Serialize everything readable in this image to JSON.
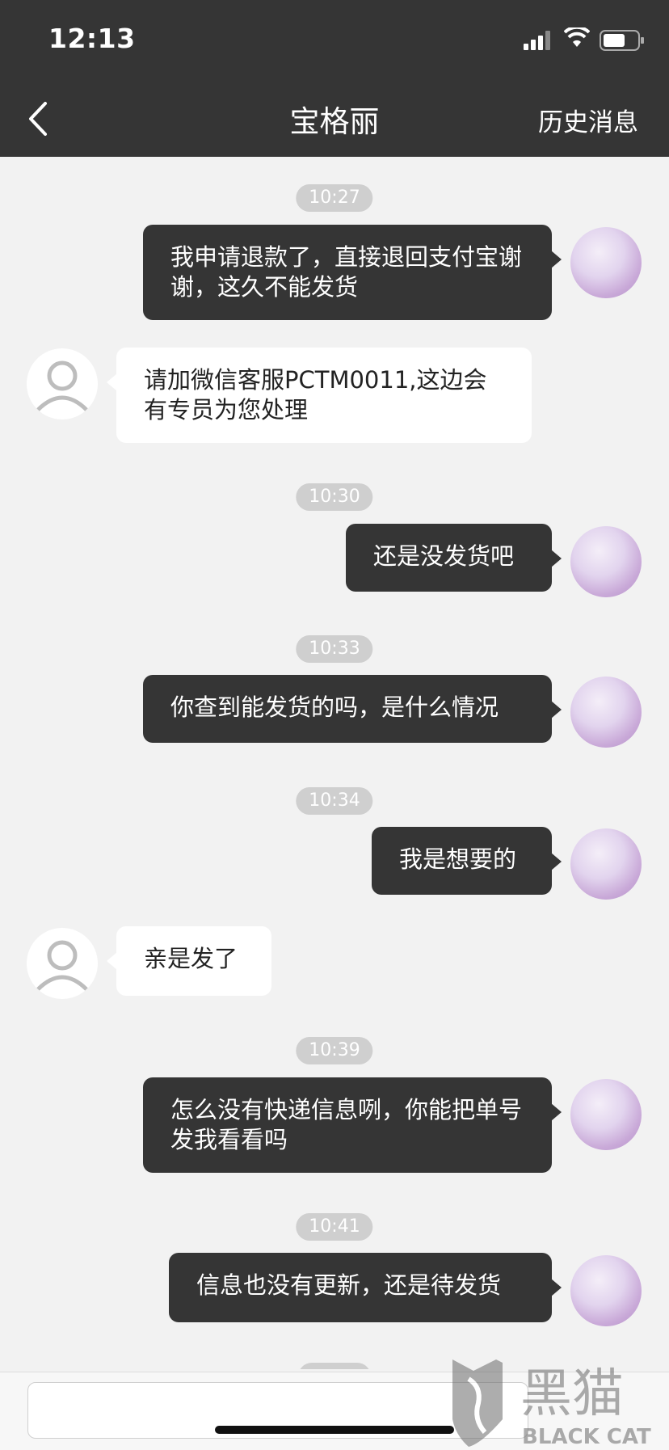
{
  "status": {
    "time": "12:13"
  },
  "header": {
    "title": "宝格丽",
    "history": "历史消息"
  },
  "messages": [
    {
      "time": "10:27"
    },
    {
      "text": "我申请退款了，直接退回支付宝谢谢，这久不能发货"
    },
    {
      "text": "请加微信客服PCTM0011,这边会有专员为您处理"
    },
    {
      "time": "10:30"
    },
    {
      "text": "还是没发货吧"
    },
    {
      "time": "10:33"
    },
    {
      "text": "你查到能发货的吗，是什么情况"
    },
    {
      "time": "10:34"
    },
    {
      "text": "我是想要的"
    },
    {
      "text": "亲是发了"
    },
    {
      "time": "10:39"
    },
    {
      "text": "怎么没有快递信息咧，你能把单号发我看看吗"
    },
    {
      "time": "10:41"
    },
    {
      "text": "信息也没有更新，还是待发货"
    }
  ],
  "watermark": {
    "brand": "黑猫",
    "brand_en": "BLACK CAT"
  },
  "icons": {
    "back": "chevron-left-icon",
    "signal": "signal-icon",
    "wifi": "wifi-icon",
    "battery": "battery-icon",
    "avatar_user": "user-avatar",
    "avatar_agent": "default-person-avatar"
  },
  "colors": {
    "bar": "#353535",
    "background": "#f2f2f2",
    "outgoing_bubble": "#353535",
    "incoming_bubble": "#ffffff",
    "timestamp": "#cfcfcf"
  }
}
